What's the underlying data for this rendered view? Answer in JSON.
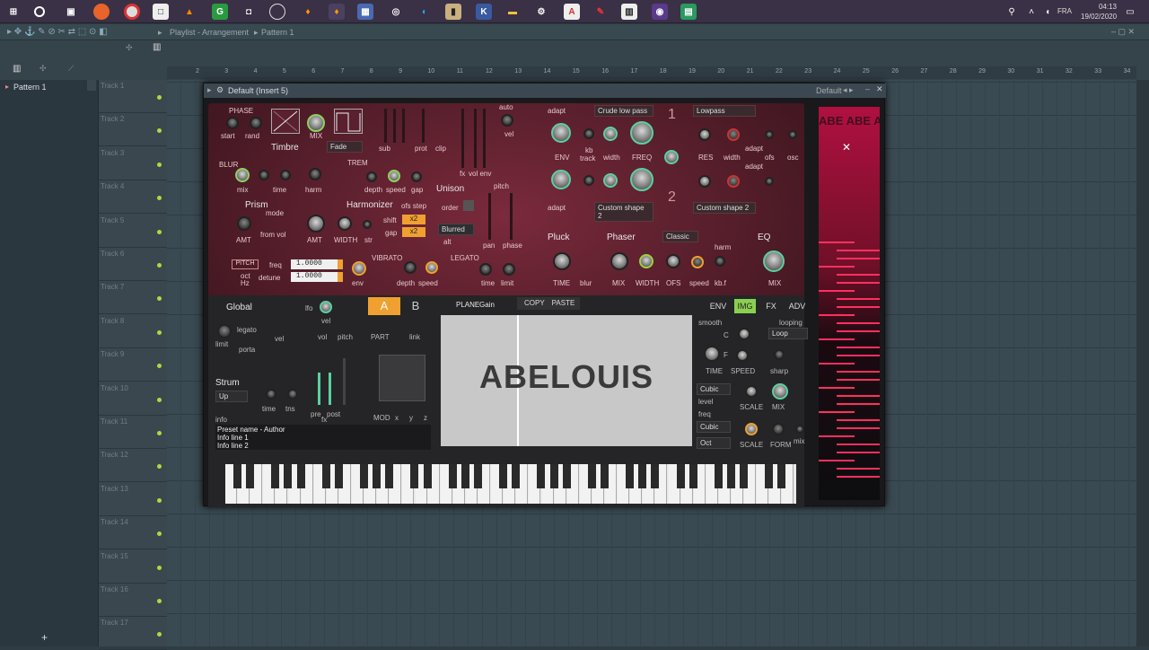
{
  "taskbar": {
    "lang": "FRA",
    "time": "04:13",
    "date": "19/02/2020"
  },
  "fl": {
    "breadcrumb": "Playlist - Arrangement",
    "pattern_sel": "Pattern 1"
  },
  "browser": {
    "pattern": "Pattern 1"
  },
  "ruler": [
    "2",
    "3",
    "4",
    "5",
    "6",
    "7",
    "8",
    "9",
    "10",
    "11",
    "12",
    "13",
    "14",
    "15",
    "16",
    "17",
    "18",
    "19",
    "20",
    "21",
    "22",
    "23",
    "24",
    "25",
    "26",
    "27",
    "28",
    "29",
    "30",
    "31",
    "32",
    "33",
    "34"
  ],
  "tracks": [
    "Track 1",
    "Track 2",
    "Track 3",
    "Track 4",
    "Track 5",
    "Track 6",
    "Track 7",
    "Track 8",
    "Track 9",
    "Track 10",
    "Track 11",
    "Track 12",
    "Track 13",
    "Track 14",
    "Track 15",
    "Track 16",
    "Track 17"
  ],
  "plugin": {
    "title": "Default (Insert 5)",
    "preset": "Default",
    "labels": {
      "phase": "PHASE",
      "start": "start",
      "rand": "rand",
      "mix": "MIX",
      "timbre": "Timbre",
      "fade": "Fade",
      "sub": "sub",
      "prot": "prot",
      "clip": "clip",
      "fx": "fx",
      "volenv": "vol env",
      "auto": "auto",
      "vel": "vel",
      "blur": "BLUR",
      "blurmix": "mix",
      "time": "time",
      "harm": "harm",
      "trem": "TREM",
      "depth": "depth",
      "speed": "speed",
      "gap": "gap",
      "unison": "Unison",
      "order": "order",
      "pitch": "pitch",
      "pan": "pan",
      "phase2": "phase",
      "blurred": "Blurred",
      "alt": "alt",
      "prism": "Prism",
      "mode": "mode",
      "amt": "AMT",
      "fromvol": "from vol",
      "harmonizer": "Harmonizer",
      "ofsstep": "ofs step",
      "shift": "shift",
      "hgap": "gap",
      "hamt": "AMT",
      "width": "WIDTH",
      "str": "str",
      "x2a": "x2",
      "x2b": "x2",
      "pitchbtn": "PITCH",
      "oct": "oct",
      "hz": "Hz",
      "freq": "freq",
      "detune": "detune",
      "freqval": "1.0000",
      "detuneval": "1.0000",
      "env": "env",
      "vibrato": "VIBRATO",
      "vdepth": "depth",
      "vspeed": "speed",
      "legato": "LEGATO",
      "ltime": "time",
      "limit": "limit",
      "adapt1": "adapt",
      "filter1": "Crude low pass",
      "lowpass": "Lowpass",
      "envk": "ENV",
      "kb": "kb",
      "track": "track",
      "fwidth": "width",
      "freqk": "FREQ",
      "res": "RES",
      "width2": "width",
      "ofs": "ofs",
      "osc": "osc",
      "adapt2": "adapt",
      "adapt3": "adapt",
      "shape1": "Custom shape 2",
      "shape2": "Custom shape 2",
      "n1": "1",
      "n2": "2",
      "pluck": "Pluck",
      "ptime": "TIME",
      "pblur": "blur",
      "phaser": "Phaser",
      "classic": "Classic",
      "pmix": "MIX",
      "pwidth": "WIDTH",
      "pofs": "OFS",
      "pspeed": "speed",
      "kbf": "kb.f",
      "harmp": "harm",
      "eq": "EQ",
      "eqmix": "MIX",
      "global": "Global",
      "lfo": "lfo",
      "gvel": "vel",
      "limitg": "limit",
      "legato2": "legato",
      "porta": "porta",
      "gvel2": "vel",
      "vol": "vol",
      "gpitch": "pitch",
      "part": "PART",
      "link": "link",
      "a": "A",
      "b": "B",
      "plane": "PLANE",
      "gain": "Gain",
      "copy": "COPY",
      "paste": "PASTE",
      "strum": "Strum",
      "up": "Up",
      "stime": "time",
      "tns": "tns",
      "pre": "pre",
      "post": "post",
      "fxl": "fx",
      "mod": "MOD",
      "x": "x",
      "y": "y",
      "z": "z",
      "info": "info",
      "infoname": "Preset name - Author",
      "info1": "Info line 1",
      "info2": "Info line 2",
      "env_tab": "ENV",
      "img_tab": "IMG",
      "fx_tab": "FX",
      "adv_tab": "ADV",
      "smooth": "smooth",
      "looping": "looping",
      "loop": "Loop",
      "c": "C",
      "f": "F",
      "itime": "TIME",
      "ispeed": "SPEED",
      "sharp": "sharp",
      "cubic1": "Cubic",
      "level": "level",
      "scale1": "SCALE",
      "imix": "MIX",
      "ifreq": "freq",
      "cubic2": "Cubic",
      "oct2": "Oct",
      "scale2": "SCALE",
      "form": "FORM",
      "imix2": "mix"
    },
    "logo": "ABELOUIS",
    "sidelogo": "ABE ABE AB"
  }
}
